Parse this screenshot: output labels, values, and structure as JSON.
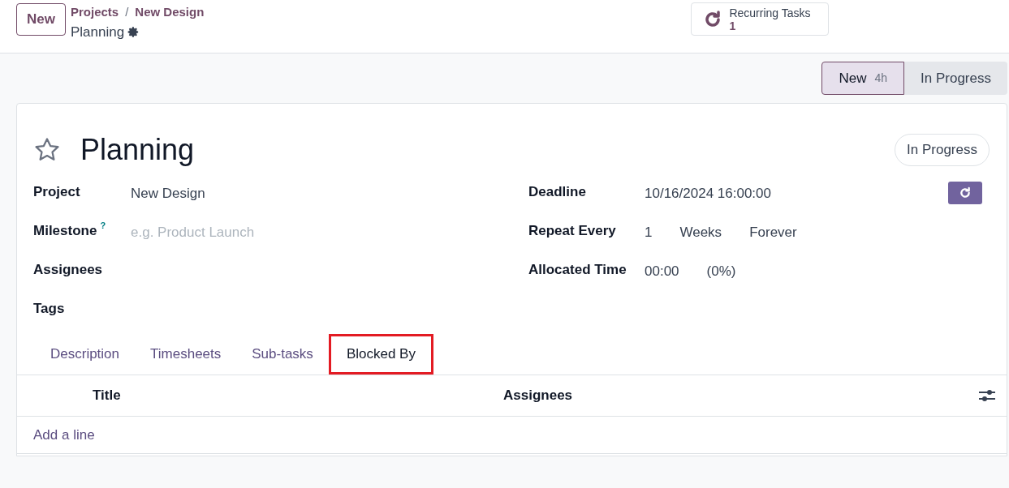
{
  "header": {
    "new_button": "New",
    "breadcrumbs": [
      "Projects",
      "New Design"
    ],
    "separator": "/",
    "record": "Planning",
    "smart_button": {
      "label": "Recurring Tasks",
      "count": "1"
    }
  },
  "stages": [
    {
      "label": "New",
      "badge": "4h",
      "selected": true
    },
    {
      "label": "In Progress",
      "selected": false
    }
  ],
  "form": {
    "title": "Planning",
    "starred": false,
    "state_button": "In Progress",
    "recurrent": true,
    "left_fields": [
      {
        "label": "Project",
        "value": "New Design"
      },
      {
        "label": "Milestone",
        "placeholder": "e.g. Product Launch",
        "help_mark": "?"
      },
      {
        "label": "Assignees"
      },
      {
        "label": "Tags"
      }
    ],
    "right_fields": [
      {
        "label": "Deadline",
        "values": [
          "10/16/2024 16:00:00"
        ]
      },
      {
        "label": "Repeat Every",
        "values": [
          "1",
          "Weeks",
          "Forever"
        ]
      },
      {
        "label": "Allocated Time",
        "values": [
          "00:00",
          "(0%)"
        ]
      }
    ],
    "tabs": [
      {
        "label": "Description",
        "selected": false
      },
      {
        "label": "Timesheets",
        "selected": false
      },
      {
        "label": "Sub-tasks",
        "selected": false
      },
      {
        "label": "Blocked By",
        "selected": true
      }
    ],
    "table": {
      "columns": [
        "Title",
        "Assignees"
      ],
      "add_line": "Add a line"
    }
  }
}
